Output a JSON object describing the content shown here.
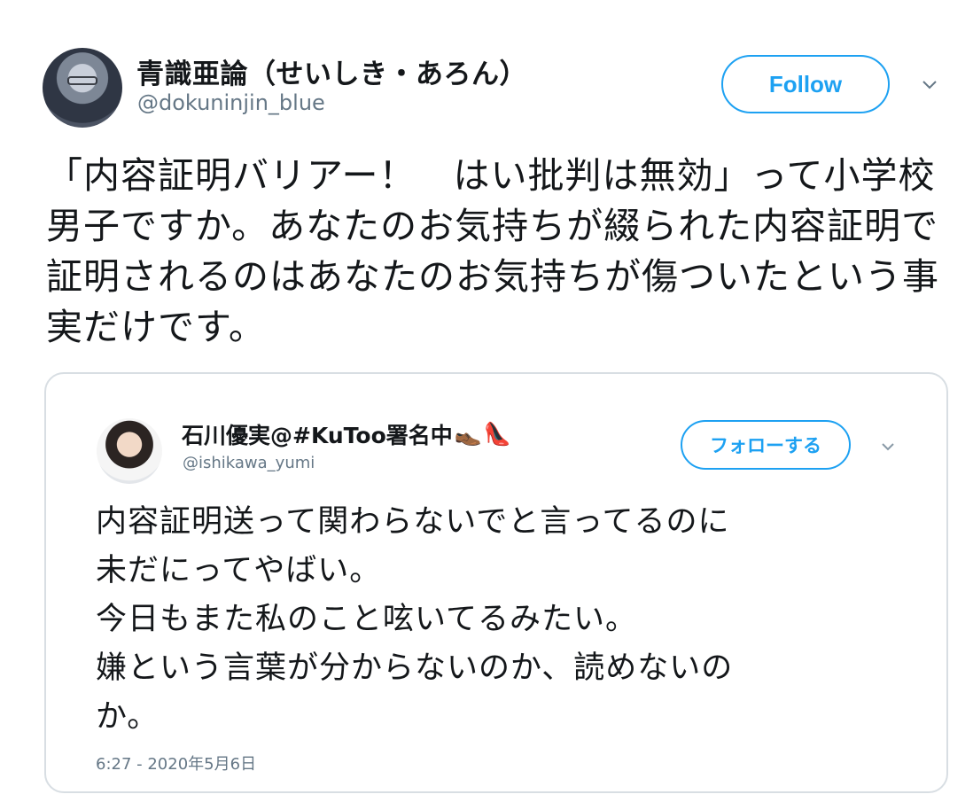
{
  "tweet": {
    "author_name": "青識亜論（せいしき・あろん）",
    "author_handle": "@dokuninjin_blue",
    "follow_label": "Follow",
    "text": "「内容証明バリアー！　はい批判は無効」って小学校男子ですか。あなたのお気持ちが綴られた内容証明で証明されるのはあなたのお気持ちが傷ついたという事実だけです。",
    "avatar_icon": "user-avatar",
    "menu_icon": "chevron-down-icon"
  },
  "quoted_tweet": {
    "author_name": "石川優実@#KuToo署名中",
    "author_emoji": [
      "👞",
      "👠"
    ],
    "author_handle": "@ishikawa_yumi",
    "follow_label": "フォローする",
    "text": "内容証明送って関わらないでと言ってるのに\n未だにってやばい。\n今日もまた私のこと呟いてるみたい。\n嫌という言葉が分からないのか、読めないの\nか。",
    "timestamp": "6:27 - 2020年5月6日",
    "menu_icon": "chevron-down-icon"
  },
  "colors": {
    "accent": "#1da1f2",
    "secondary_text": "#657786",
    "border": "#d8dee3"
  }
}
